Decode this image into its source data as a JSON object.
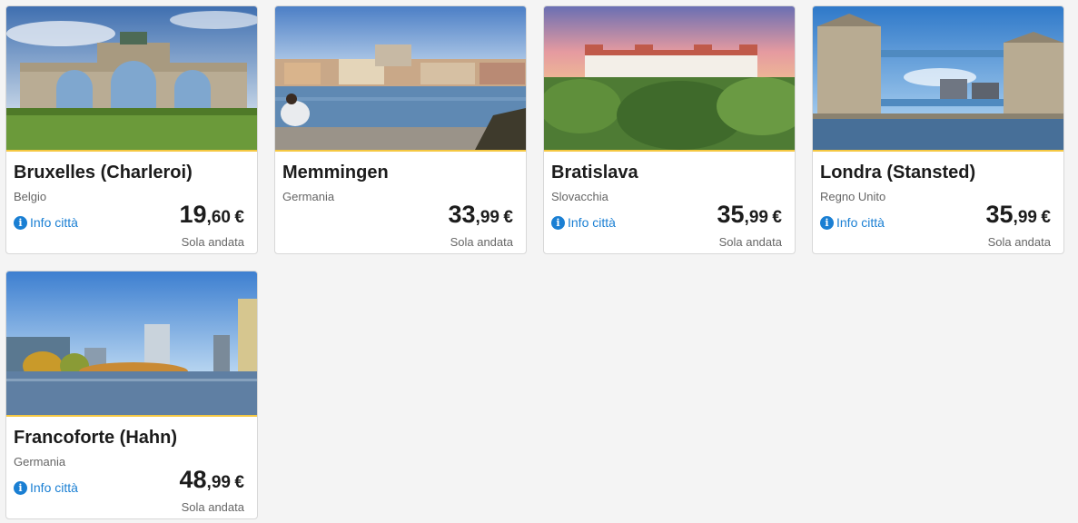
{
  "colors": {
    "accent": "#f5c842",
    "price_text": "#1c1c1c",
    "link": "#1a7fd3"
  },
  "cards": [
    {
      "city": "Bruxelles (Charleroi)",
      "country": "Belgio",
      "has_info": true,
      "info_label": "Info città",
      "price_int": "19",
      "price_dec": ",60",
      "currency": "€",
      "fare_type": "Sola andata",
      "image": "arch-park-icon"
    },
    {
      "city": "Memmingen",
      "country": "Germania",
      "has_info": false,
      "info_label": "",
      "price_int": "33",
      "price_dec": ",99",
      "currency": "€",
      "fare_type": "Sola andata",
      "image": "lake-town-icon"
    },
    {
      "city": "Bratislava",
      "country": "Slovacchia",
      "has_info": true,
      "info_label": "Info città",
      "price_int": "35",
      "price_dec": ",99",
      "currency": "€",
      "fare_type": "Sola andata",
      "image": "castle-icon"
    },
    {
      "city": "Londra (Stansted)",
      "country": "Regno Unito",
      "has_info": true,
      "info_label": "Info città",
      "price_int": "35",
      "price_dec": ",99",
      "currency": "€",
      "fare_type": "Sola andata",
      "image": "tower-bridge-icon"
    },
    {
      "city": "Francoforte (Hahn)",
      "country": "Germania",
      "has_info": true,
      "info_label": "Info città",
      "price_int": "48",
      "price_dec": ",99",
      "currency": "€",
      "fare_type": "Sola andata",
      "image": "skyline-river-icon"
    }
  ]
}
